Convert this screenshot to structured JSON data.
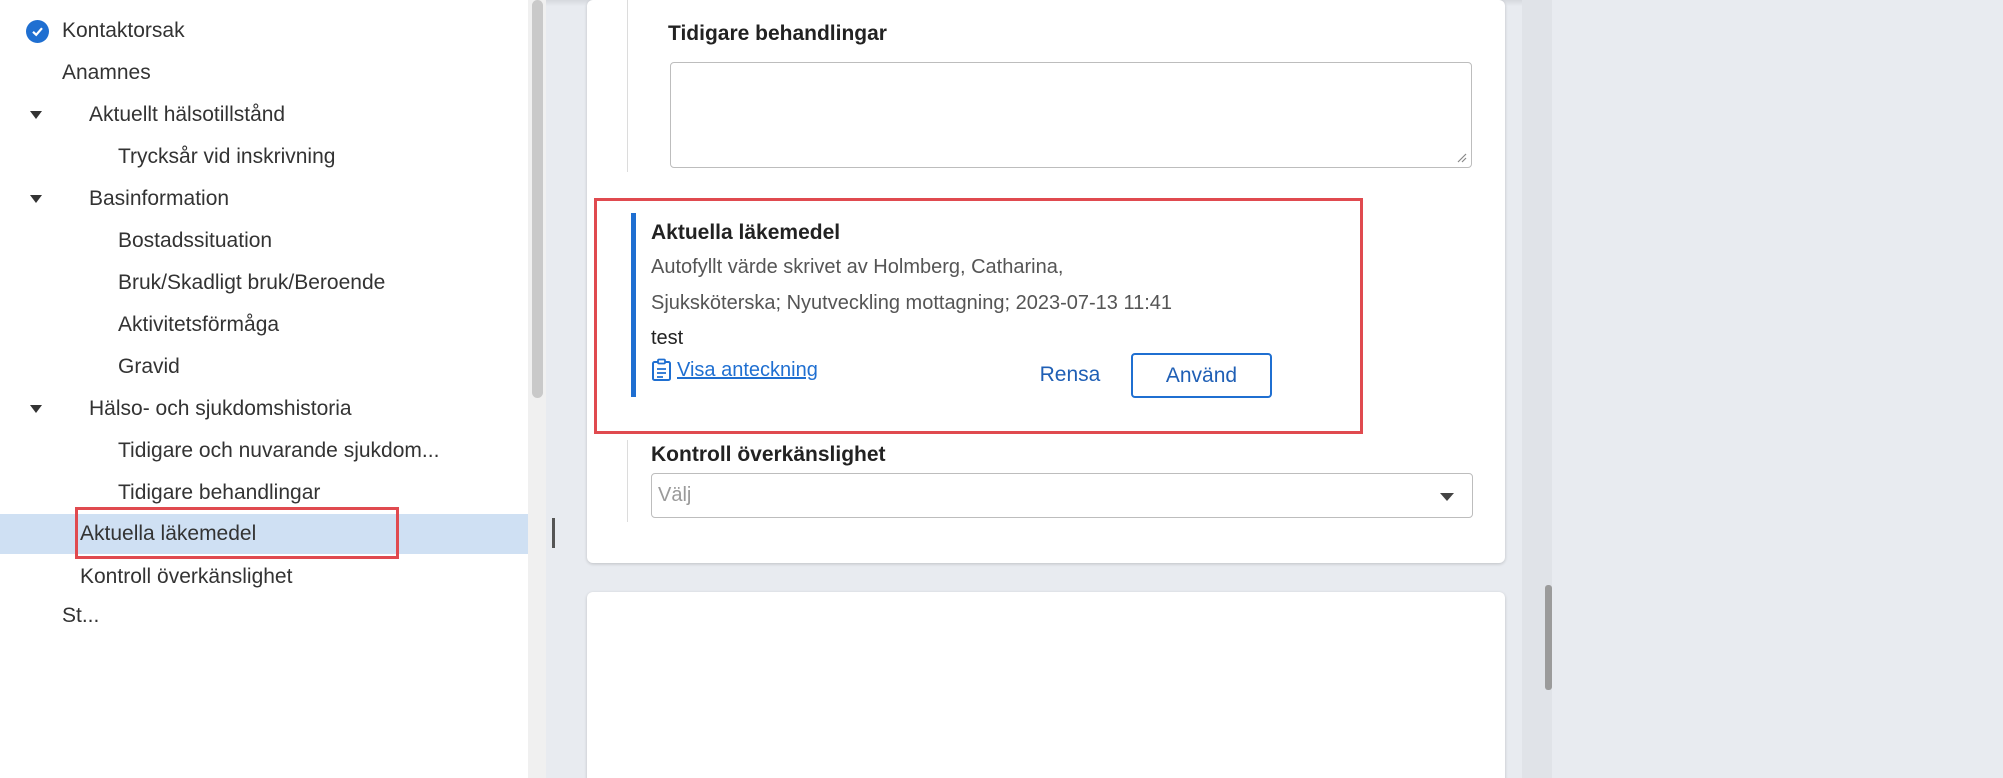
{
  "nav": {
    "items": [
      {
        "label": "Kontaktorsak"
      },
      {
        "label": "Anamnes"
      },
      {
        "label": "Aktuellt hälsotillstånd"
      },
      {
        "label": "Trycksår vid inskrivning"
      },
      {
        "label": "Basinformation"
      },
      {
        "label": "Bostadssituation"
      },
      {
        "label": "Bruk/Skadligt bruk/Beroende"
      },
      {
        "label": "Aktivitetsförmåga"
      },
      {
        "label": "Gravid"
      },
      {
        "label": "Hälso- och sjukdomshistoria"
      },
      {
        "label": "Tidigare och nuvarande sjukdom..."
      },
      {
        "label": "Tidigare behandlingar"
      },
      {
        "label": "Aktuella läkemedel"
      },
      {
        "label": "Kontroll överkänslighet"
      },
      {
        "label": "St..."
      }
    ]
  },
  "form": {
    "previous_treatments": {
      "label": "Tidigare behandlingar",
      "value": ""
    },
    "current_medication": {
      "label": "Aktuella läkemedel",
      "autofill_line1": "Autofyllt värde skrivet av Holmberg, Catharina,",
      "autofill_line2": "Sjuksköterska; Nyutveckling mottagning; 2023-07-13 11:41",
      "autofill_value": "test",
      "view_note_label": "Visa anteckning",
      "clear_label": "Rensa",
      "apply_label": "Använd"
    },
    "allergy_check": {
      "label": "Kontroll överkänslighet",
      "selected_value": "Välj"
    }
  },
  "colors": {
    "accent": "#1f6fd1",
    "highlight": "#e04a4f",
    "selected_bg": "#cfe0f3"
  }
}
